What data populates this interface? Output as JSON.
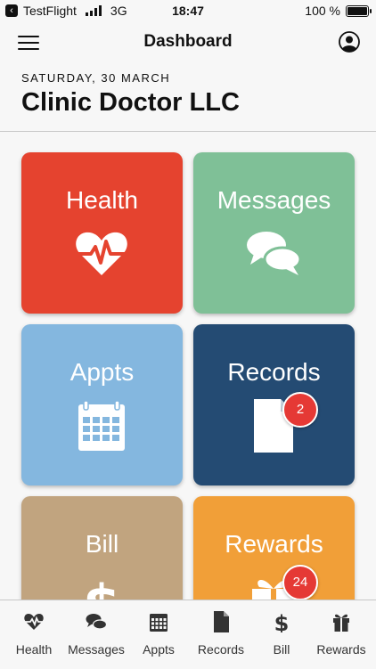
{
  "status_bar": {
    "back_app": "TestFlight",
    "network": "3G",
    "time": "18:47",
    "battery": "100 %",
    "battery_level": 1.0
  },
  "nav": {
    "title": "Dashboard",
    "menu_icon": "hamburger-menu-icon",
    "profile_icon": "user-profile-icon"
  },
  "header": {
    "date": "SATURDAY, 30 MARCH",
    "clinic": "Clinic Doctor LLC"
  },
  "tiles": [
    {
      "label": "Health",
      "color": "#e5432f",
      "icon": "heartbeat-icon"
    },
    {
      "label": "Messages",
      "color": "#7fc097",
      "icon": "chat-bubbles-icon"
    },
    {
      "label": "Appts",
      "color": "#84b7df",
      "icon": "calendar-icon"
    },
    {
      "label": "Records",
      "color": "#244b73",
      "icon": "document-icon",
      "badge": "2"
    },
    {
      "label": "Bill",
      "color": "#c1a47f",
      "icon": "dollar-icon"
    },
    {
      "label": "Rewards",
      "color": "#f19f38",
      "icon": "gift-icon",
      "badge": "24"
    }
  ],
  "tabs": [
    {
      "label": "Health",
      "icon": "heartbeat-icon"
    },
    {
      "label": "Messages",
      "icon": "chat-bubbles-icon"
    },
    {
      "label": "Appts",
      "icon": "calendar-icon"
    },
    {
      "label": "Records",
      "icon": "document-icon"
    },
    {
      "label": "Bill",
      "icon": "dollar-icon"
    },
    {
      "label": "Rewards",
      "icon": "gift-icon"
    }
  ]
}
